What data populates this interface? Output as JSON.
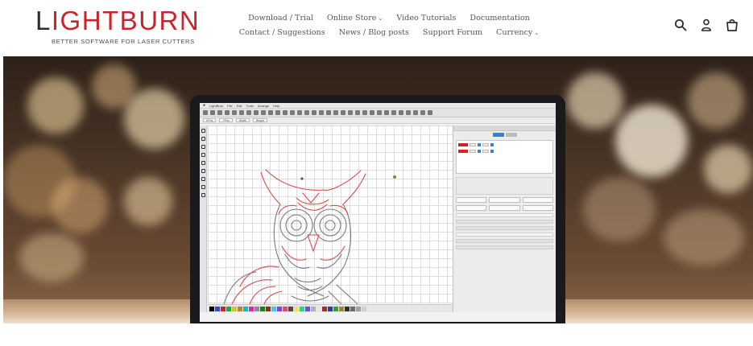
{
  "brand": {
    "logo_text_first": "L",
    "logo_text_rest": "IGHTBURN",
    "tagline": "BETTER SOFTWARE FOR LASER CUTTERS",
    "accent_color": "#c8242c"
  },
  "nav": {
    "row1": [
      {
        "label": "Download / Trial",
        "has_dropdown": false
      },
      {
        "label": "Online Store",
        "has_dropdown": true
      },
      {
        "label": "Video Tutorials",
        "has_dropdown": false
      },
      {
        "label": "Documentation",
        "has_dropdown": false
      }
    ],
    "row2": [
      {
        "label": "Contact / Suggestions",
        "has_dropdown": false
      },
      {
        "label": "News / Blog posts",
        "has_dropdown": false
      },
      {
        "label": "Support Forum",
        "has_dropdown": false
      },
      {
        "label": "Currency",
        "has_dropdown": true
      }
    ],
    "caret_glyph": "⌄"
  },
  "header_icons": [
    "search-icon",
    "account-icon",
    "cart-icon"
  ],
  "hero": {
    "image_subject": "laptop-showing-lightburn-owl-design",
    "app_menu": [
      "LightBurn",
      "File",
      "Edit",
      "Tools",
      "Arrange",
      "Help"
    ],
    "field_labels": [
      "XPos",
      "YPos",
      "Width",
      "Height"
    ],
    "palette_colors": [
      "#000000",
      "#2b4bd1",
      "#c8242c",
      "#27a63c",
      "#d1c52b",
      "#d47a1e",
      "#13b8c7",
      "#d42bb8",
      "#8c8c8c",
      "#1a7f1a",
      "#7a3b14",
      "#3ec8f0",
      "#8f3ed4",
      "#e04a7a",
      "#4b4b4b",
      "#f0e15a",
      "#2bd19a",
      "#5a5ad1",
      "#b3b3b3",
      "#e6e6e6",
      "#9a3030",
      "#303a9a",
      "#3a9a30",
      "#9a8a30",
      "#303030",
      "#6a6a6a",
      "#a0a0a0",
      "#d0d0d0"
    ]
  }
}
